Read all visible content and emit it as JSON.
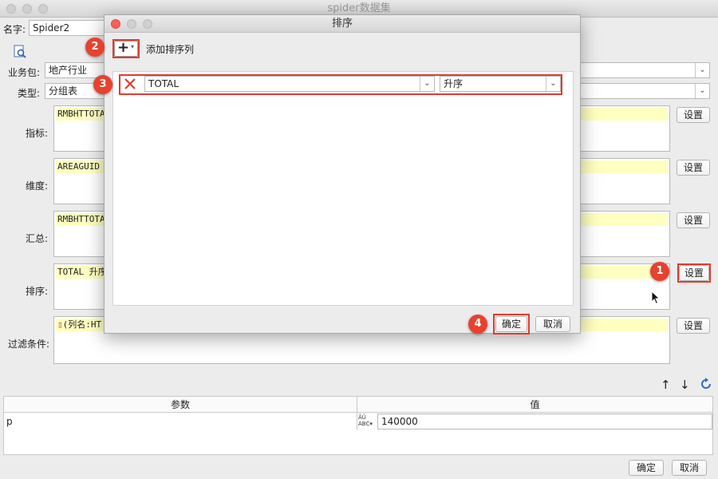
{
  "window": {
    "title": "spider数据集"
  },
  "form": {
    "name_label": "名字:",
    "name_value": "Spider2",
    "package_label": "业务包:",
    "package_value": "地产行业",
    "type_label": "类型:",
    "type_value": "分组表",
    "metrics_label": "指标:",
    "metrics_value": "RMBHTTOTA",
    "dimension_label": "维度:",
    "dimension_value": "AREAGUID",
    "summary_label": "汇总:",
    "summary_value": "RMBHTTOTA",
    "sort_label": "排序:",
    "sort_value": "TOTAL 升序",
    "filter_label": "过滤条件:",
    "filter_value": "(列名:HT",
    "settings_label": "设置"
  },
  "params": {
    "header_param": "参数",
    "header_value": "值",
    "rows": [
      {
        "name": "p",
        "value": "140000"
      }
    ]
  },
  "bottom": {
    "ok_label": "确定",
    "cancel_label": "取消"
  },
  "dialog": {
    "title": "排序",
    "add_label": "添加排序列",
    "sort_row": {
      "column": "TOTAL",
      "order": "升序"
    },
    "ok_label": "确定",
    "cancel_label": "取消"
  },
  "callouts": [
    "1",
    "2",
    "3",
    "4"
  ],
  "colors": {
    "accent_red": "#e8412f",
    "highlight_yellow": "#ffffc0"
  }
}
